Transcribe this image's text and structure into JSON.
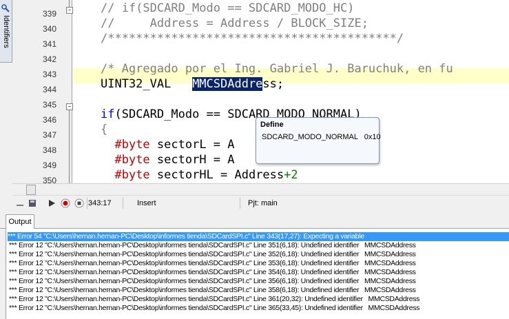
{
  "side_tab": {
    "label": "Identifiers"
  },
  "editor": {
    "line_numbers": [
      "339",
      "340",
      "341",
      "342",
      "343",
      "344",
      "345",
      "346",
      "347",
      "348",
      "349",
      "350"
    ],
    "lines": [
      {
        "parts": [
          {
            "c": "comment",
            "t": "// if(SDCARD_Modo == SDCARD_MODO_HC)"
          }
        ]
      },
      {
        "parts": [
          {
            "c": "comment",
            "t": "//     Address = Address / BLOCK_SIZE;"
          }
        ]
      },
      {
        "parts": [
          {
            "c": "comment",
            "t": "/*****************************************/"
          }
        ]
      },
      {
        "parts": [
          {
            "c": "",
            "t": ""
          }
        ]
      },
      {
        "parts": [
          {
            "c": "comment",
            "t": "/* Agregado por el Ing. Gabriel J. Baruchuk, en fu"
          }
        ]
      },
      {
        "parts": [
          {
            "c": "",
            "t": "UINT32_VAL   "
          },
          {
            "c": "sel",
            "t": "MMCSDAddre"
          },
          {
            "c": "",
            "t": "ss;"
          }
        ]
      },
      {
        "parts": [
          {
            "c": "",
            "t": ""
          }
        ]
      },
      {
        "parts": [
          {
            "c": "keyword",
            "t": "if"
          },
          {
            "c": "",
            "t": "(SDCARD_Modo == SDCARD_MODO_NORMAL)"
          }
        ]
      },
      {
        "parts": [
          {
            "c": "comment",
            "t": "{"
          }
        ]
      },
      {
        "parts": [
          {
            "c": "",
            "t": "  "
          },
          {
            "c": "preproc",
            "t": "#byte"
          },
          {
            "c": "",
            "t": " sectorL = A"
          }
        ]
      },
      {
        "parts": [
          {
            "c": "",
            "t": "  "
          },
          {
            "c": "preproc",
            "t": "#byte"
          },
          {
            "c": "",
            "t": " sectorH = A"
          }
        ]
      },
      {
        "parts": [
          {
            "c": "",
            "t": "  "
          },
          {
            "c": "preproc",
            "t": "#byte"
          },
          {
            "c": "",
            "t": " sectorHL = Address"
          },
          {
            "c": "plus",
            "t": "+2"
          }
        ]
      }
    ]
  },
  "tooltip": {
    "title": "Define",
    "body": "SDCARD_MODO_NORMAL   0x10"
  },
  "status": {
    "position": "343:17",
    "mode": "Insert",
    "project": "Pjt: main"
  },
  "output": {
    "tab_label": "Output",
    "lines": [
      "*** Error 54 \"C:\\Users\\hernan.hernan-PC\\Desktop\\informes tienda\\SDCardSPI.c\" Line 343(17,27): Expecting a variable",
      "*** Error 12 \"C:\\Users\\hernan.hernan-PC\\Desktop\\informes tienda\\SDCardSPI.c\" Line 351(6,18): Undefined identifier   MMCSDAddress",
      "*** Error 12 \"C:\\Users\\hernan.hernan-PC\\Desktop\\informes tienda\\SDCardSPI.c\" Line 352(6,18): Undefined identifier   MMCSDAddress",
      "*** Error 12 \"C:\\Users\\hernan.hernan-PC\\Desktop\\informes tienda\\SDCardSPI.c\" Line 353(6,18): Undefined identifier   MMCSDAddress",
      "*** Error 12 \"C:\\Users\\hernan.hernan-PC\\Desktop\\informes tienda\\SDCardSPI.c\" Line 354(6,18): Undefined identifier   MMCSDAddress",
      "*** Error 12 \"C:\\Users\\hernan.hernan-PC\\Desktop\\informes tienda\\SDCardSPI.c\" Line 356(6,18): Undefined identifier   MMCSDAddress",
      "*** Error 12 \"C:\\Users\\hernan.hernan-PC\\Desktop\\informes tienda\\SDCardSPI.c\" Line 358(6,18): Undefined identifier   MMCSDAddress",
      "*** Error 12 \"C:\\Users\\hernan.hernan-PC\\Desktop\\informes tienda\\SDCardSPI.c\" Line 361(20,32): Undefined identifier   MMCSDAddress",
      "*** Error 12 \"C:\\Users\\hernan.hernan-PC\\Desktop\\informes tienda\\SDCardSPI.c\" Line 365(33,45): Undefined identifier   MMCSDAddress"
    ]
  }
}
